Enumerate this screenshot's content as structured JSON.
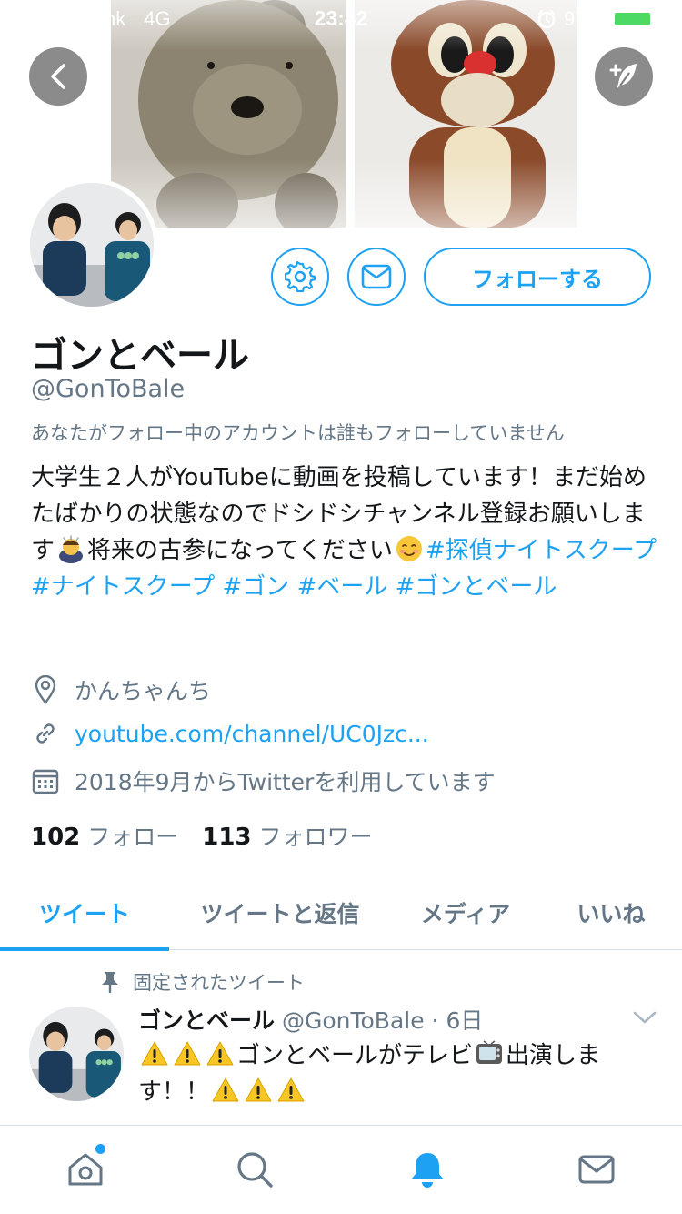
{
  "status_bar": {
    "carrier": "SoftBank",
    "network": "4G",
    "time": "23:42",
    "battery": "97%",
    "battery_level": 0.97
  },
  "profile": {
    "display_name": "ゴンとベール",
    "handle": "@GonToBale",
    "followed_by": "あなたがフォロー中のアカウントは誰もフォローしていません",
    "bio_text_1": "大学生２人がYouTubeに動画を投稿しています！まだ始めたばかりの状態なのでドシドシチャンネル登録お願いします",
    "bio_text_2": "将来の古参になってください",
    "bio_tag_1": "#探偵ナイトスクープ",
    "bio_tag_2": "#ナイトスクープ",
    "bio_tag_3": "#ゴン",
    "bio_tag_4": "#ベール",
    "bio_tag_5": "#ゴンとベール",
    "location": "かんちゃんち",
    "url": "youtube.com/channel/UC0Jzc...",
    "joined": "2018年9月からTwitterを利用しています",
    "following_count": "102",
    "following_label": "フォロー",
    "followers_count": "113",
    "followers_label": "フォロワー"
  },
  "actions": {
    "follow_label": "フォローする"
  },
  "tabs": [
    {
      "label": "ツイート",
      "active": true
    },
    {
      "label": "ツイートと返信",
      "active": false
    },
    {
      "label": "メディア",
      "active": false
    },
    {
      "label": "いいね",
      "active": false
    }
  ],
  "pinned_tweet": {
    "pinned_label": "固定されたツイート",
    "name": "ゴンとベール",
    "handle_time": "@GonToBale · 6日",
    "text_main": "ゴンとベールがテレビ",
    "text_tail_1": "出演しま",
    "text_tail_2": "す！！"
  },
  "bottom_nav": {
    "items": [
      "home-icon",
      "search-icon",
      "notifications-icon",
      "messages-icon"
    ],
    "active": "notifications-icon"
  },
  "colors": {
    "accent": "#1da1f2",
    "text_primary": "#14171a",
    "text_secondary": "#657786",
    "battery": "#4cd964"
  }
}
